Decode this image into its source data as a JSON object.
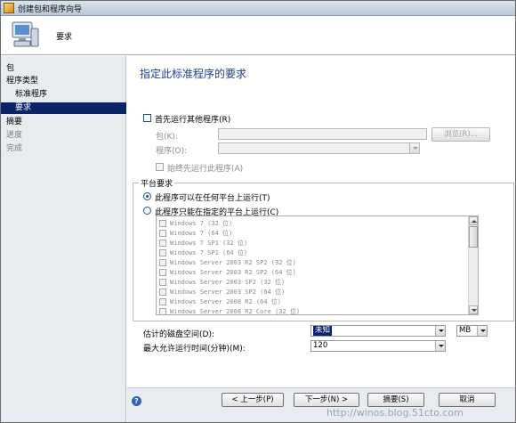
{
  "window": {
    "title": "创建包和程序向导"
  },
  "header": {
    "title": "要求"
  },
  "sidebar": {
    "items": [
      {
        "label": "包"
      },
      {
        "label": "程序类型"
      },
      {
        "label": "标准程序"
      },
      {
        "label": "要求"
      },
      {
        "label": "摘要"
      },
      {
        "label": "进度"
      },
      {
        "label": "完成"
      }
    ]
  },
  "main": {
    "title": "指定此标准程序的要求",
    "run_other_first": {
      "label": "首先运行其他程序(R)",
      "checked": false
    },
    "package_label": "包(K):",
    "package_value": "",
    "browse_label": "浏览(R)...",
    "program_label": "程序(O):",
    "program_value": "",
    "always_run_first_label": "始终先运行此程序(A)",
    "platform_group_label": "平台要求",
    "platform_any_label": "此程序可以在任何平台上运行(T)",
    "platform_specific_label": "此程序只能在指定的平台上运行(C)",
    "platforms": [
      "Windows 7 (32 位)",
      "Windows 7 (64 位)",
      "Windows 7 SP1 (32 位)",
      "Windows 7 SP1 (64 位)",
      "Windows Server 2003 R2 SP2 (32 位)",
      "Windows Server 2003 R2 SP2 (64 位)",
      "Windows Server 2003 SP2 (32 位)",
      "Windows Server 2003 SP2 (64 位)",
      "Windows Server 2008 R2 (64 位)",
      "Windows Server 2008 R2 Core (32 位)"
    ],
    "disk_space_label": "估计的磁盘空间(D):",
    "disk_space_value": "未知",
    "disk_unit_value": "MB",
    "max_runtime_label": "最大允许运行时间(分钟)(M):",
    "max_runtime_value": "120"
  },
  "footer": {
    "back_label": "< 上一步(P)",
    "next_label": "下一步(N) >",
    "summary_label": "摘要(S)",
    "cancel_label": "取消",
    "help_glyph": "?"
  },
  "watermark": "http://winos.blog.51cto.com",
  "colors": {
    "selection": "#0a246a",
    "title_blue": "#1f3c8f",
    "sidebar_bg": "#e8ecf0"
  }
}
